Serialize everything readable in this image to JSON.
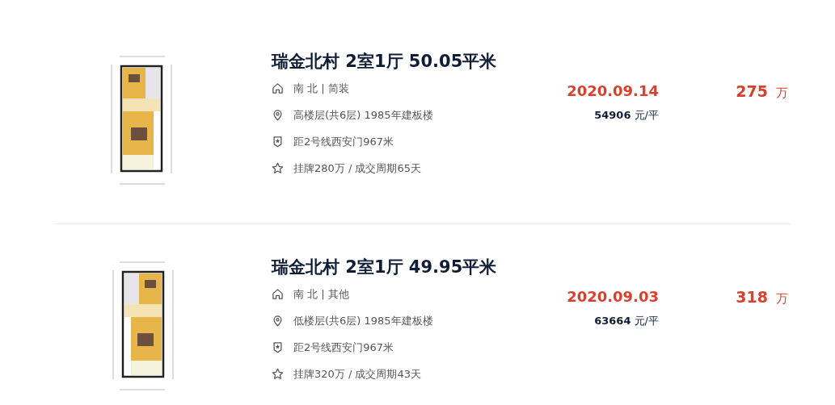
{
  "listings": [
    {
      "title": "瑞金北村 2室1厅 50.05平米",
      "details": [
        {
          "kind": "house",
          "text": "南 北 | 简装"
        },
        {
          "kind": "location",
          "text": "高楼层(共6层) 1985年建板楼"
        },
        {
          "kind": "subway",
          "text": "距2号线西安门967米"
        },
        {
          "kind": "deal",
          "text": "挂牌280万 / 成交周期65天"
        }
      ],
      "date": "2020.09.14",
      "unit_price": "54906",
      "unit_price_unit": "元/平",
      "price": "275",
      "price_unit": "万"
    },
    {
      "title": "瑞金北村 2室1厅 49.95平米",
      "details": [
        {
          "kind": "house",
          "text": "南 北 | 其他"
        },
        {
          "kind": "location",
          "text": "低楼层(共6层) 1985年建板楼"
        },
        {
          "kind": "subway",
          "text": "距2号线西安门967米"
        },
        {
          "kind": "deal",
          "text": "挂牌320万 / 成交周期43天"
        }
      ],
      "date": "2020.09.03",
      "unit_price": "63664",
      "unit_price_unit": "元/平",
      "price": "318",
      "price_unit": "万"
    }
  ]
}
